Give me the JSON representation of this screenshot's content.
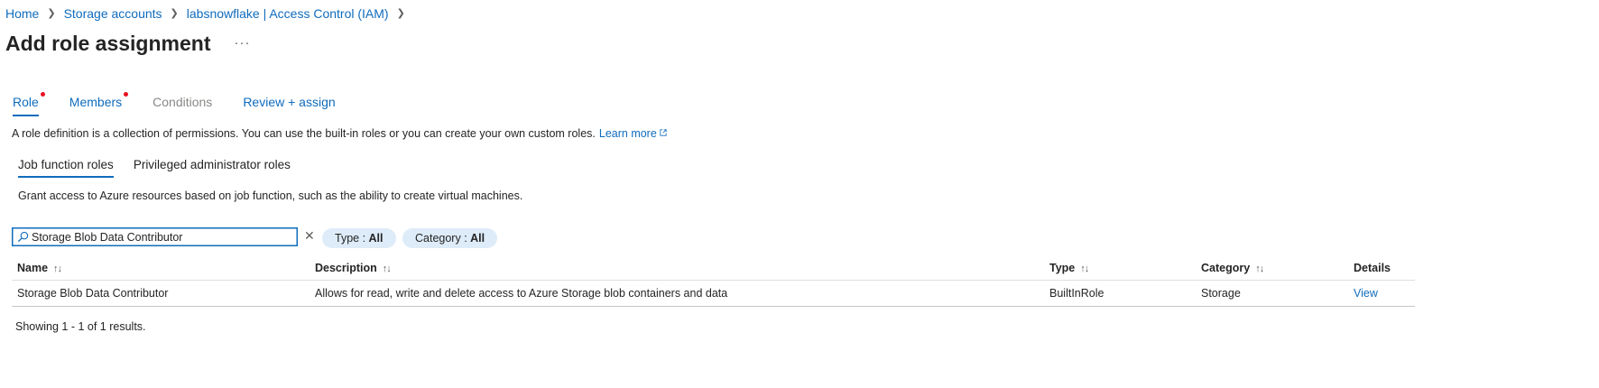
{
  "breadcrumb": [
    {
      "label": "Home"
    },
    {
      "label": "Storage accounts"
    },
    {
      "label": "labsnowflake | Access Control (IAM)"
    }
  ],
  "title": "Add role assignment",
  "more_label": "···",
  "main_tabs": [
    {
      "label": "Role",
      "state": "active",
      "required": true
    },
    {
      "label": "Members",
      "state": "enabled",
      "required": true
    },
    {
      "label": "Conditions",
      "state": "disabled",
      "required": false
    },
    {
      "label": "Review + assign",
      "state": "enabled",
      "required": false
    }
  ],
  "role_description": "A role definition is a collection of permissions. You can use the built-in roles or you can create your own custom roles.",
  "learn_more": "Learn more",
  "sub_tabs": [
    {
      "label": "Job function roles",
      "active": true
    },
    {
      "label": "Privileged administrator roles",
      "active": false
    }
  ],
  "sub_description": "Grant access to Azure resources based on job function, such as the ability to create virtual machines.",
  "search": {
    "value": "Storage Blob Data Contributor",
    "clear_label": "✕"
  },
  "filters": {
    "type": {
      "label": "Type : ",
      "value": "All"
    },
    "category": {
      "label": "Category : ",
      "value": "All"
    }
  },
  "table": {
    "columns": [
      {
        "label": "Name",
        "sort_icon": "↑↓"
      },
      {
        "label": "Description",
        "sort_icon": "↑↓"
      },
      {
        "label": "Type",
        "sort_icon": "↑↓"
      },
      {
        "label": "Category",
        "sort_icon": "↑↓"
      },
      {
        "label": "Details",
        "sort_icon": ""
      }
    ],
    "rows": [
      {
        "name": "Storage Blob Data Contributor",
        "description": "Allows for read, write and delete access to Azure Storage blob containers and data",
        "type": "BuiltInRole",
        "category": "Storage",
        "details": "View"
      }
    ]
  },
  "results_text": "Showing 1 - 1 of 1 results.",
  "colors": {
    "accent": "#0f6cbd",
    "required_dot": "#e81123",
    "pill_bg": "#deecf9"
  },
  "icons": {
    "breadcrumb_separator": "chevron-right-icon",
    "search": "search-icon",
    "clear": "close-icon",
    "external_link": "external-link-icon",
    "sort": "sort-icon"
  }
}
